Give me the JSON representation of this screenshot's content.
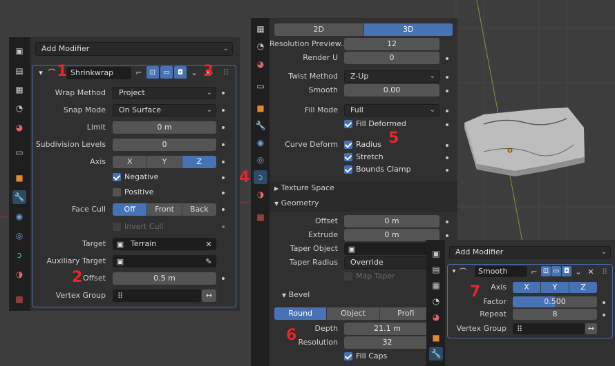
{
  "left_panel": {
    "add_modifier": "Add Modifier",
    "modifier_name": "Shrinkwrap",
    "rows": {
      "wrap_method_label": "Wrap Method",
      "wrap_method_value": "Project",
      "snap_mode_label": "Snap Mode",
      "snap_mode_value": "On Surface",
      "limit_label": "Limit",
      "limit_value": "0 m",
      "subdiv_label": "Subdivision Levels",
      "subdiv_value": "0",
      "axis_label": "Axis",
      "axis_x": "X",
      "axis_y": "Y",
      "axis_z": "Z",
      "negative": "Negative",
      "positive": "Positive",
      "face_cull_label": "Face Cull",
      "cull_off": "Off",
      "cull_front": "Front",
      "cull_back": "Back",
      "invert_cull": "Invert Cull",
      "target_label": "Target",
      "target_value": "Terrain",
      "aux_target_label": "Auxiliary Target",
      "offset_label": "Offset",
      "offset_value": "0.5 m",
      "vgroup_label": "Vertex Group"
    }
  },
  "middle_panel": {
    "mode_2d": "2D",
    "mode_3d": "3D",
    "res_preview_label": "Resolution Preview...",
    "res_preview_value": "12",
    "render_u_label": "Render U",
    "render_u_value": "0",
    "twist_method_label": "Twist Method",
    "twist_method_value": "Z-Up",
    "smooth_label": "Smooth",
    "smooth_value": "0.00",
    "fill_mode_label": "Fill Mode",
    "fill_mode_value": "Full",
    "fill_deformed": "Fill Deformed",
    "curve_deform_label": "Curve Deform",
    "radius": "Radius",
    "stretch": "Stretch",
    "bounds_clamp": "Bounds Clamp",
    "texture_space": "Texture Space",
    "geometry": "Geometry",
    "offset_label": "Offset",
    "offset_value": "0 m",
    "extrude_label": "Extrude",
    "extrude_value": "0 m",
    "taper_object_label": "Taper Object",
    "taper_radius_label": "Taper Radius",
    "taper_radius_value": "Override",
    "map_taper": "Map Taper",
    "bevel": "Bevel",
    "bevel_round": "Round",
    "bevel_object": "Object",
    "bevel_profile": "Profi",
    "depth_label": "Depth",
    "depth_value": "21.1 m",
    "resolution_label": "Resolution",
    "resolution_value": "32",
    "fill_caps": "Fill Caps"
  },
  "right_panel": {
    "add_modifier": "Add Modifier",
    "modifier_name": "Smooth",
    "axis_label": "Axis",
    "axis_x": "X",
    "axis_y": "Y",
    "axis_z": "Z",
    "factor_label": "Factor",
    "factor_value": "0.500",
    "repeat_label": "Repeat",
    "repeat_value": "8",
    "vgroup_label": "Vertex Group"
  },
  "annotations": {
    "n1": "1",
    "n2": "2",
    "n3": "3",
    "n4": "4",
    "n5": "5",
    "n6": "6",
    "n7": "7"
  },
  "colors": {
    "accent": "#4772b3",
    "annotation": "#e8252a",
    "panel": "#303030"
  }
}
